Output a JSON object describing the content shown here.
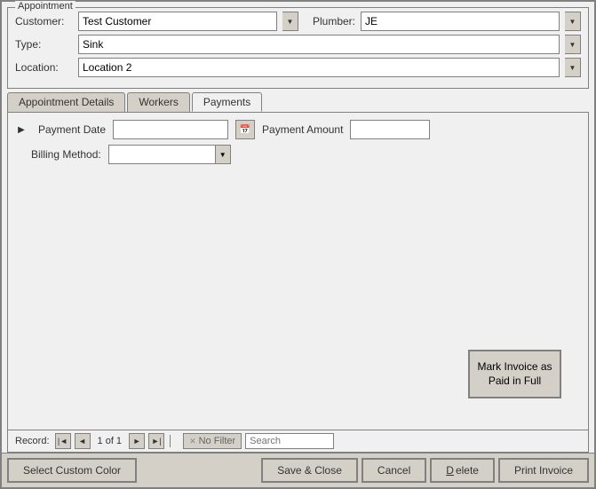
{
  "window": {
    "title": "Appointment"
  },
  "appointment": {
    "customer_label": "Customer:",
    "customer_value": "Test Customer",
    "plumber_label": "Plumber:",
    "plumber_value": "JE",
    "type_label": "Type:",
    "type_value": "Sink",
    "location_label": "Location:",
    "location_value": "Location 2"
  },
  "tabs": [
    {
      "id": "appointment-details",
      "label": "Appointment Details",
      "active": false
    },
    {
      "id": "workers",
      "label": "Workers",
      "active": false
    },
    {
      "id": "payments",
      "label": "Payments",
      "active": true
    }
  ],
  "payments": {
    "payment_date_label": "Payment Date",
    "payment_amount_label": "Payment Amount",
    "billing_method_label": "Billing Method:",
    "payment_date_value": "",
    "payment_amount_value": "",
    "billing_method_value": ""
  },
  "mark_invoice_btn": "Mark Invoice as Paid in Full",
  "record_nav": {
    "label": "Record:",
    "first": "|◄",
    "prev": "◄",
    "info": "1 of 1",
    "next": "►",
    "last": "►|",
    "no_filter": "No Filter",
    "search_placeholder": "Search"
  },
  "toolbar": {
    "select_custom_color": "Select Custom Color",
    "save_close": "Save & Close",
    "cancel": "Cancel",
    "delete": "Delete",
    "print_invoice": "Print Invoice"
  }
}
